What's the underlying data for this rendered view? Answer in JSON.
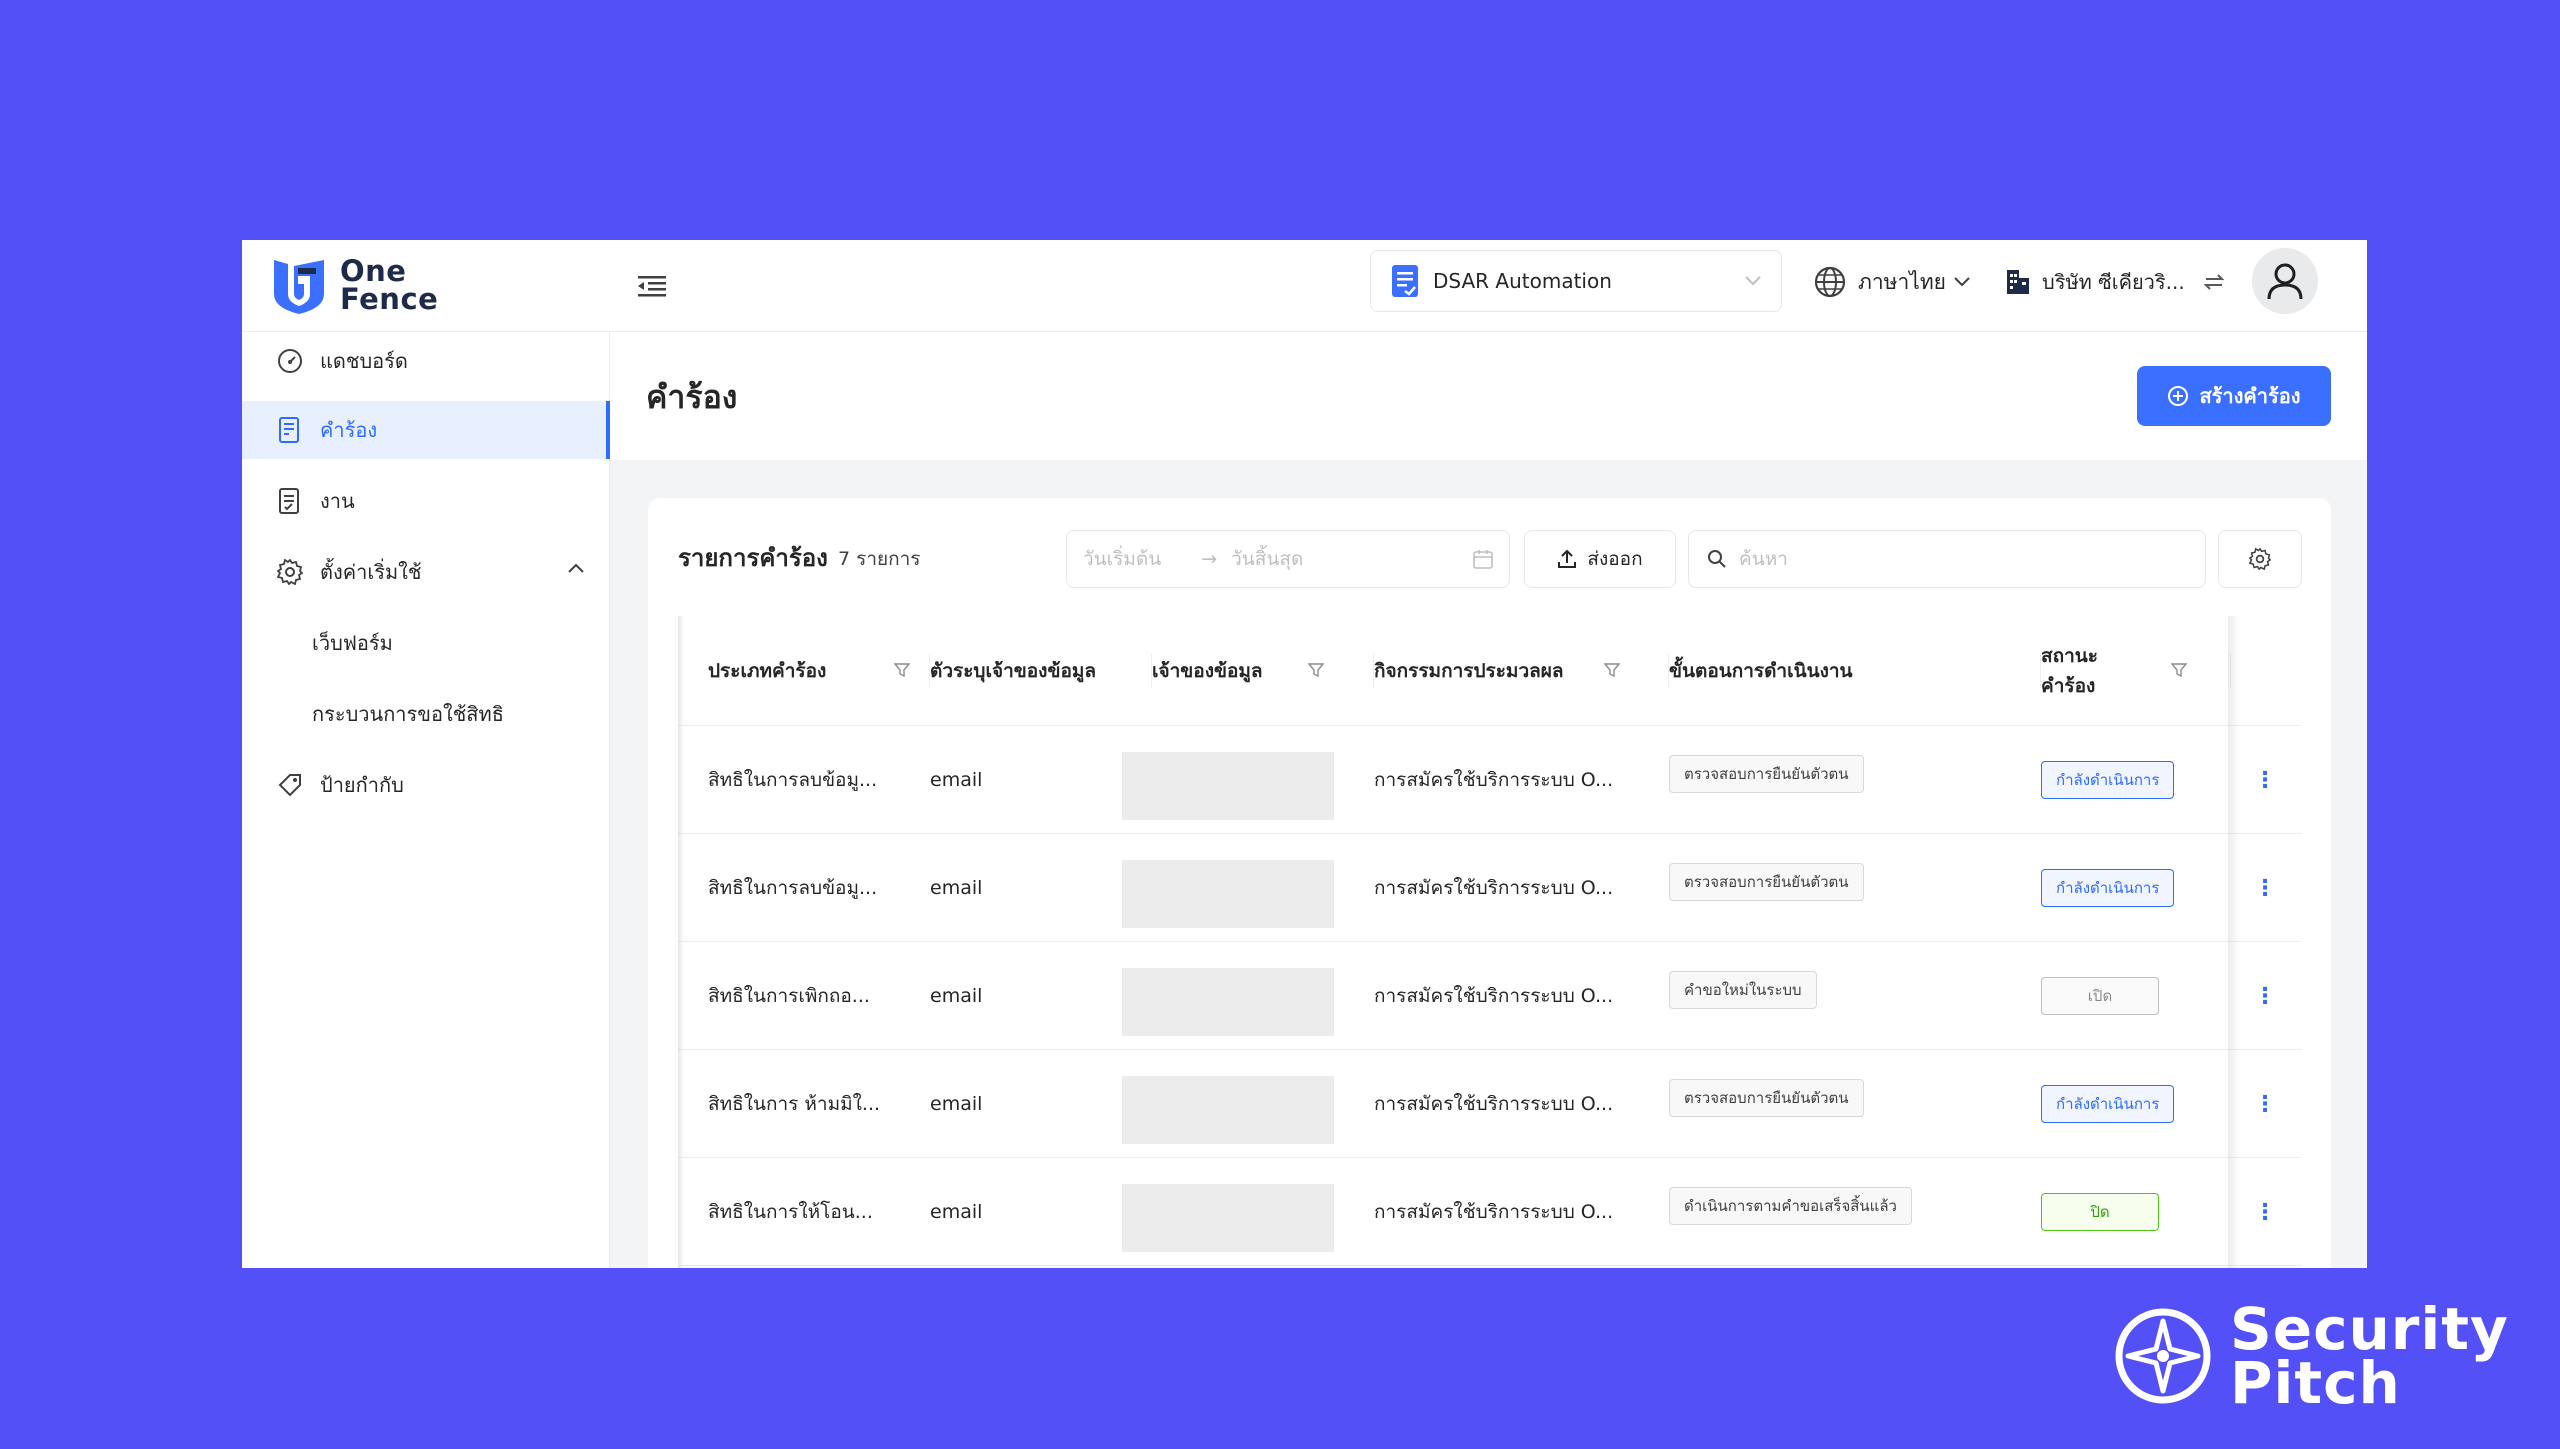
{
  "app": {
    "logo_line1": "One",
    "logo_line2": "Fence",
    "product": "DSAR Automation",
    "language": "ภาษาไทย",
    "company": "บริษัท ซีเคียวริ..."
  },
  "sidebar": {
    "items": [
      {
        "label": "แดชบอร์ด",
        "icon": "dashboard-gauge-icon"
      },
      {
        "label": "คำร้อง",
        "icon": "request-form-icon"
      },
      {
        "label": "งาน",
        "icon": "task-list-icon"
      },
      {
        "label": "ตั้งค่าเริ่มใช้",
        "icon": "gear-icon"
      },
      {
        "label": "เว็บฟอร์ม"
      },
      {
        "label": "กระบวนการขอใช้สิทธิ"
      },
      {
        "label": "ป้ายกำกับ",
        "icon": "tag-icon"
      }
    ]
  },
  "page": {
    "title": "คำร้อง",
    "create_label": "สร้างคำร้อง"
  },
  "list": {
    "title": "รายการคำร้อง",
    "count": "7 รายการ",
    "date_start_placeholder": "วันเริ่มต้น",
    "date_end_placeholder": "วันสิ้นสุด",
    "export_label": "ส่งออก",
    "search_placeholder": "ค้นหา"
  },
  "table": {
    "headers": {
      "type": "ประเภทคำร้อง",
      "identifier": "ตัวระบุเจ้าของข้อมูล",
      "owner": "เจ้าของข้อมูล",
      "activity": "กิจกรรมการประมวลผล",
      "step": "ขั้นตอนการดำเนินงาน",
      "status_line1": "สถานะ",
      "status_line2": "คำร้อง"
    },
    "rows": [
      {
        "type": "สิทธิในการลบข้อมู...",
        "identifier": "email",
        "activity": "การสมัครใช้บริการระบบ O...",
        "step": "ตรวจสอบการยืนยันตัวตน",
        "status": "กำลังดำเนินการ"
      },
      {
        "type": "สิทธิในการลบข้อมู...",
        "identifier": "email",
        "activity": "การสมัครใช้บริการระบบ O...",
        "step": "ตรวจสอบการยืนยันตัวตน",
        "status": "กำลังดำเนินการ"
      },
      {
        "type": "สิทธิในการเพิกถอ...",
        "identifier": "email",
        "activity": "การสมัครใช้บริการระบบ O...",
        "step": "คำขอใหม่ในระบบ",
        "status": "เปิด"
      },
      {
        "type": "สิทธิในการ ห้ามมิใ...",
        "identifier": "email",
        "activity": "การสมัครใช้บริการระบบ O...",
        "step": "ตรวจสอบการยืนยันตัวตน",
        "status": "กำลังดำเนินการ"
      },
      {
        "type": "สิทธิในการให้โอน...",
        "identifier": "email",
        "activity": "การสมัครใช้บริการระบบ O...",
        "step": "ดำเนินการตามคำขอเสร็จสิ้นแล้ว",
        "status": "ปิด"
      }
    ]
  },
  "footer_brand": {
    "line1": "Security",
    "line2": "Pitch"
  },
  "colors": {
    "background": "#5350f7",
    "accent": "#3b6fff",
    "status_in_progress": "#2f6bff",
    "status_open": "#8c8c8c",
    "status_closed": "#52c41a"
  }
}
